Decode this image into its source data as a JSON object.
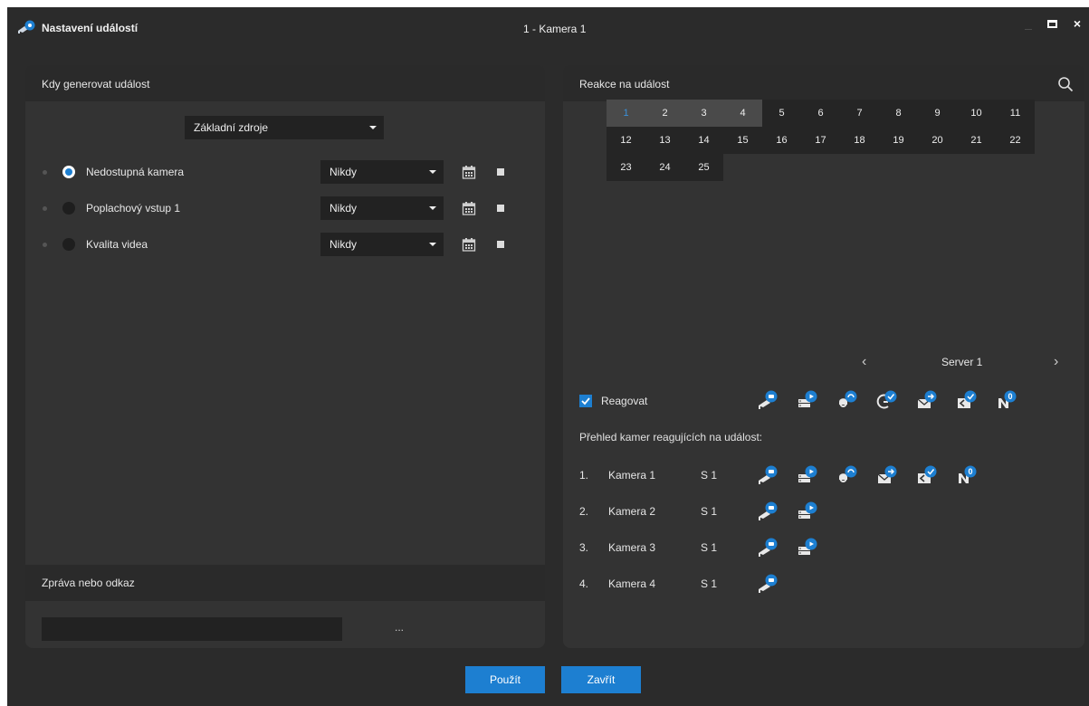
{
  "window": {
    "title": "Nastavení událostí",
    "camera": "1 - Kamera 1",
    "minimize": "_",
    "close": "×"
  },
  "left": {
    "header": "Kdy generovat událost",
    "source_select": "Základní zdroje",
    "events": [
      {
        "label": "Nedostupná kamera",
        "selected": true,
        "schedule": "Nikdy"
      },
      {
        "label": "Poplachový vstup 1",
        "selected": false,
        "schedule": "Nikdy"
      },
      {
        "label": "Kvalita videa",
        "selected": false,
        "schedule": "Nikdy"
      }
    ],
    "message_header": "Zpráva nebo odkaz",
    "message_value": "",
    "browse": "..."
  },
  "right": {
    "header": "Reakce na událost",
    "grid": [
      "1",
      "2",
      "3",
      "4",
      "5",
      "6",
      "7",
      "8",
      "9",
      "10",
      "11",
      "12",
      "13",
      "14",
      "15",
      "16",
      "17",
      "18",
      "19",
      "20",
      "21",
      "22",
      "23",
      "24",
      "25"
    ],
    "selected_cells": [
      "1",
      "2",
      "3",
      "4"
    ],
    "prev": "‹",
    "next": "›",
    "server": "Server 1",
    "react_label": "Reagovat",
    "react_checked": true,
    "overview_title": "Přehled kamer reagujících na událost:",
    "cameras": [
      {
        "num": "1.",
        "name": "Kamera 1",
        "server": "S 1",
        "icons": [
          "camera-alert-icon",
          "recording-server-icon",
          "output-icon",
          "email-icon",
          "client-notify-icon",
          "notification-icon"
        ]
      },
      {
        "num": "2.",
        "name": "Kamera 2",
        "server": "S 1",
        "icons": [
          "camera-alert-icon",
          "recording-server-icon"
        ]
      },
      {
        "num": "3.",
        "name": "Kamera 3",
        "server": "S 1",
        "icons": [
          "camera-alert-icon",
          "recording-server-icon"
        ]
      },
      {
        "num": "4.",
        "name": "Kamera 4",
        "server": "S 1",
        "icons": [
          "camera-alert-icon"
        ]
      }
    ],
    "notification_count": "0"
  },
  "buttons": {
    "apply": "Použít",
    "close": "Zavřít"
  },
  "colors": {
    "accent": "#1d7fd1",
    "background": "#2b2b2b",
    "panel": "#333333"
  }
}
